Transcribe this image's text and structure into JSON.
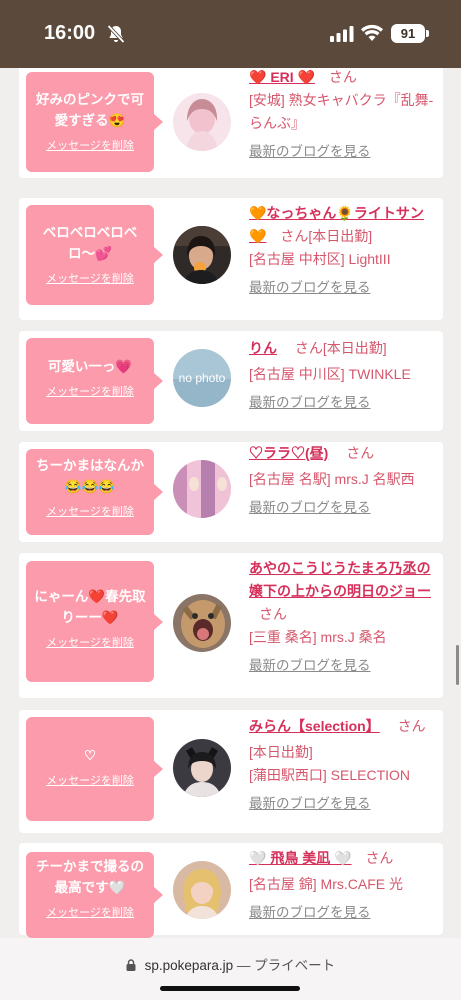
{
  "status_bar": {
    "time": "16:00",
    "battery": "91"
  },
  "feed": {
    "cards": [
      {
        "message": "好みのピンクで可愛すぎる😍",
        "delete_label": "メッセージを削除",
        "name": "❤️ ERI ❤️",
        "honorific": "さん",
        "shop": "[安城] 熟女キャバクラ『乱舞-らんぶ』",
        "blog_link": "最新のブログを見る",
        "avatar": "pink-portrait"
      },
      {
        "message": "ベロベロベロベロ〜💕",
        "delete_label": "メッセージを削除",
        "name": "🧡なっちゃん🌻ライトサン🧡",
        "honorific": "さん[本日出勤]",
        "shop": "[名古屋 中村区] LightIII",
        "blog_link": "最新のブログを見る",
        "avatar": "dark-portrait"
      },
      {
        "message": "可愛い一っ💗",
        "delete_label": "メッセージを削除",
        "name": "りん",
        "honorific": "さん[本日出勤]",
        "shop": "[名古屋 中川区] TWINKLE",
        "blog_link": "最新のブログを見る",
        "avatar": "no-photo",
        "avatar_text": "no photo"
      },
      {
        "message": "ちーかまはなんか😂😂😂",
        "delete_label": "メッセージを削除",
        "name": "♡ララ♡(昼)",
        "honorific": "さん",
        "shop": "[名古屋 名駅] mrs.J 名駅西",
        "blog_link": "最新のブログを見る",
        "avatar": "pink-hair"
      },
      {
        "message": "にゃーん❤️春先取りーー❤️",
        "delete_label": "メッセージを削除",
        "name": "あやのこうじうたまろ乃丞の嬢下の上からの明日のジョー",
        "honorific": "さん",
        "shop": "[三重 桑名] mrs.J 桑名",
        "blog_link": "最新のブログを見る",
        "avatar": "cat"
      },
      {
        "message": "♡",
        "delete_label": "メッセージを削除",
        "name": "みらん【selection】",
        "honorific": "さん",
        "shop": "[本日出勤]",
        "shop2": "[蒲田駅西口] SELECTION",
        "blog_link": "最新のブログを見る",
        "avatar": "cat-ears"
      },
      {
        "message": "チーかまで撮るの最高です🤍",
        "delete_label": "メッセージを削除",
        "name": "🤍 飛鳥 美凪 🤍",
        "honorific": "さん",
        "shop": "[名古屋 錦] Mrs.CAFE 光",
        "blog_link": "最新のブログを見る",
        "avatar": "blonde"
      }
    ]
  },
  "browser": {
    "domain": "sp.pokepara.jp",
    "privacy": "— プライベート"
  },
  "colors": {
    "accent_pink": "#fc9bab",
    "name_red": "#d6305a",
    "status_brown": "#5b4a3b"
  }
}
